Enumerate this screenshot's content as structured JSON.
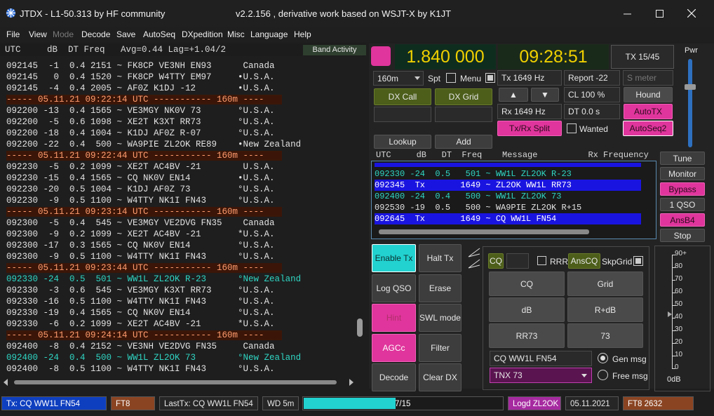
{
  "window": {
    "title_left": "JTDX - L1-50.313  by HF community",
    "title_center": "v2.2.156 , derivative work based on WSJT-X by K1JT",
    "buttons": [
      "minimize",
      "maximize",
      "close"
    ]
  },
  "menu": [
    "File",
    "View",
    "Mode",
    "Decode",
    "Save",
    "AutoSeq",
    "DXpedition",
    "Misc",
    "Language",
    "Help"
  ],
  "band": {
    "header": "UTC     dB  DT Freq   Avg=0.44 Lag=+1.04/2",
    "activity_label": "Band Activity",
    "lines": [
      {
        "t": "092145  -1  0.4 2151 ~ FK8CP VE3NH EN93      Canada",
        "c": "n"
      },
      {
        "t": "092145   0  0.4 1520 ~ FK8CP W4TTY EM97     •U.S.A.",
        "c": "n"
      },
      {
        "t": "092145  -4  0.4 2005 ~ AF0Z K1DJ -12        •U.S.A.",
        "c": "n"
      },
      {
        "t": "----- 05.11.21 09:22:14 UTC ----------- 160m ----",
        "c": "s"
      },
      {
        "t": "092200 -13  0.4 1565 ~ VE3MGY NK0V 73       °U.S.A.",
        "c": "n"
      },
      {
        "t": "092200  -5  0.6 1098 ~ XE2T K3XT RR73       °U.S.A.",
        "c": "n"
      },
      {
        "t": "092200 -18  0.4 1004 ~ K1DJ AF0Z R-07       °U.S.A.",
        "c": "n"
      },
      {
        "t": "092200 -22  0.4  500 ~ WA9PIE ZL2OK RE89    •New Zealand",
        "c": "n"
      },
      {
        "t": "----- 05.11.21 09:22:44 UTC ----------- 160m ----",
        "c": "s"
      },
      {
        "t": "092230  -5  0.2 1099 ~ XE2T AC4BV -21        U.S.A.",
        "c": "n"
      },
      {
        "t": "092230 -15  0.4 1565 ~ CQ NK0V EN14         •U.S.A.",
        "c": "n"
      },
      {
        "t": "092230 -20  0.5 1004 ~ K1DJ AF0Z 73         °U.S.A.",
        "c": "n"
      },
      {
        "t": "092230  -9  0.5 1100 ~ W4TTY NK1I FN43      °U.S.A.",
        "c": "n"
      },
      {
        "t": "----- 05.11.21 09:23:14 UTC ----------- 160m ----",
        "c": "s"
      },
      {
        "t": "092300  -5  0.4  545 ~ VE3MGY VE2DVG FN35    Canada",
        "c": "n"
      },
      {
        "t": "092300  -9  0.2 1099 ~ XE2T AC4BV -21       *U.S.A.",
        "c": "n"
      },
      {
        "t": "092300 -17  0.3 1565 ~ CQ NK0V EN14         °U.S.A.",
        "c": "n"
      },
      {
        "t": "092300  -9  0.5 1100 ~ W4TTY NK1I FN43      °U.S.A.",
        "c": "n"
      },
      {
        "t": "----- 05.11.21 09:23:44 UTC ----------- 160m ----",
        "c": "s"
      },
      {
        "t": "092330 -24  0.5  501 ~ WW1L ZL2OK R-23      °New Zealand",
        "c": "c"
      },
      {
        "t": "092330  -3  0.6  545 ~ VE3MGY K3XT RR73     °U.S.A.",
        "c": "n"
      },
      {
        "t": "092330 -16  0.5 1100 ~ W4TTY NK1I FN43      °U.S.A.",
        "c": "n"
      },
      {
        "t": "092330 -19  0.4 1565 ~ CQ NK0V EN14         °U.S.A.",
        "c": "n"
      },
      {
        "t": "092330  -6  0.2 1099 ~ XE2T AC4BV -21       *U.S.A.",
        "c": "n"
      },
      {
        "t": "----- 05.11.21 09:24:14 UTC ----------- 160m ----",
        "c": "s"
      },
      {
        "t": "092400  -8  0.4 2152 ~ VE3NH VE2DVG FN35     Canada",
        "c": "n"
      },
      {
        "t": "092400 -24  0.4  500 ~ WW1L ZL2OK 73        °New Zealand",
        "c": "c"
      },
      {
        "t": "092400  -8  0.5 1100 ~ W4TTY NK1I FN43      °U.S.A.",
        "c": "n"
      }
    ]
  },
  "freq_display": "1.840 000",
  "time_display": "09:28:51",
  "tx_period": "TX 15/45",
  "pwr_label": "Pwr",
  "band_select": "160m",
  "spt_label": "Spt",
  "menu_label": "Menu",
  "tx_freq": "Tx  1649  Hz",
  "rx_freq": "Rx  1649  Hz",
  "report": "Report -22",
  "smeter_placeholder": "S meter",
  "cl": "CL  100 %",
  "dt": "DT 0.0 s",
  "hound": "Hound",
  "autotx": "AutoTX",
  "autoseq2": "AutoSeq2",
  "dx_call": "DX Call",
  "dx_grid": "DX Grid",
  "lookup": "Lookup",
  "add": "Add",
  "txrx_split": "Tx/Rx Split",
  "wanted": "Wanted",
  "arrow_up": "▲",
  "arrow_down": "▼",
  "rx_header": "UTC     dB   DT  Freq    Message          Rx Frequency",
  "rx_lines": [
    {
      "t": "092330 -24  0.5   501 ~ WW1L ZL2OK R-23",
      "k": "c"
    },
    {
      "t": "092345  Tx       1649 ~ ZL2OK WW1L RR73",
      "k": "tx"
    },
    {
      "t": "092400 -24  0.4   500 ~ WW1L ZL2OK 73",
      "k": "c"
    },
    {
      "t": "092530 -19  0.5   500 ~ WA9PIE ZL2OK R+15",
      "k": "n"
    },
    {
      "t": "092645  Tx       1649 ~ CQ WW1L FN54",
      "k": "tx"
    }
  ],
  "side_buttons": [
    "Tune",
    "Monitor",
    "Bypass",
    "1 QSO",
    "AnsB4",
    "Stop"
  ],
  "left_buttons": [
    "Enable Tx",
    "Halt Tx",
    "Log QSO",
    "Erase",
    "Hint",
    "SWL mode",
    "AGCc",
    "Filter",
    "Decode",
    "Clear DX"
  ],
  "macro": {
    "cq": "CQ",
    "rrr": "RRR",
    "anscq": "AnsCQ",
    "skpgrid": "SkpGrid",
    "grid_buttons": [
      "CQ",
      "Grid",
      "dB",
      "R+dB",
      "RR73",
      "73"
    ],
    "gen_field": "CQ WW1L FN54",
    "free_field": "TNX 73",
    "gen_msg": "Gen msg",
    "free_msg": "Free msg"
  },
  "meter": {
    "ticks": [
      "90+",
      "80",
      "70",
      "60",
      "50",
      "40",
      "30",
      "20",
      "10",
      "0"
    ],
    "value": "0dB"
  },
  "status": {
    "tx": "Tx: CQ WW1L FN54",
    "mode": "FT8",
    "last_tx": "LastTx: CQ WW1L FN54",
    "wd": "WD 5m",
    "progress": "7/15",
    "progress_fraction": 0.46,
    "logged": "Logd ZL2OK",
    "date": "05.11.2021",
    "mode_count": "FT8  2632"
  }
}
